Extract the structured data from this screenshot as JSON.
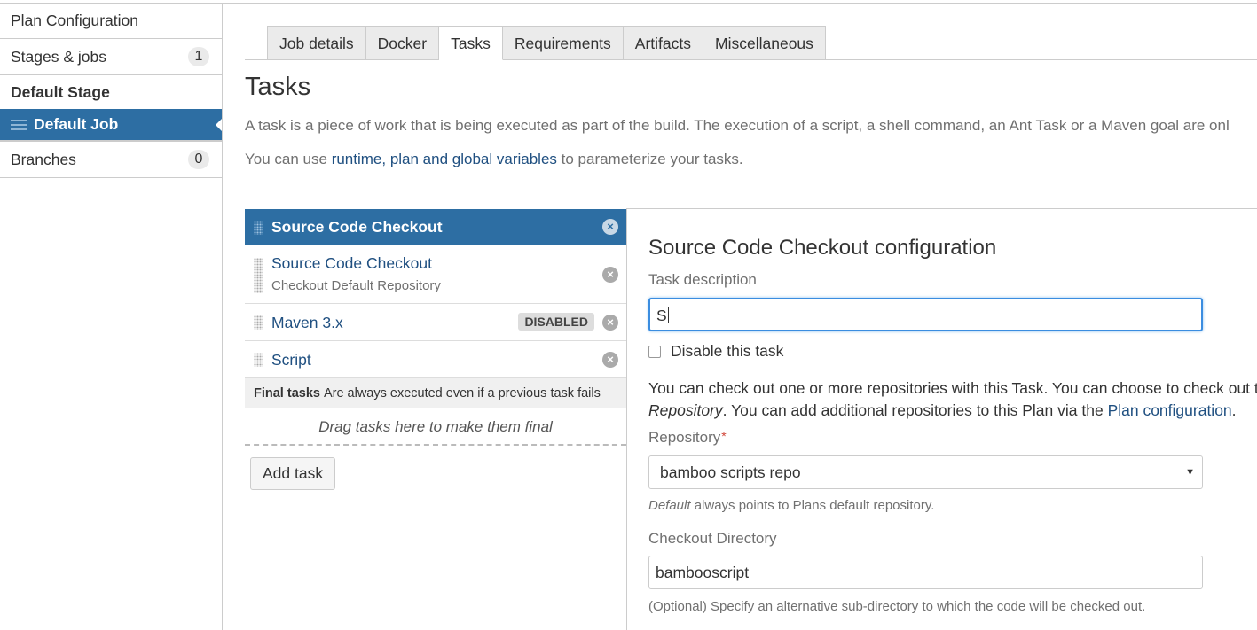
{
  "sidebar": {
    "plan_configuration": "Plan Configuration",
    "stages_jobs": {
      "label": "Stages & jobs",
      "count": "1"
    },
    "stage_name": "Default Stage",
    "job_name": "Default Job",
    "branches": {
      "label": "Branches",
      "count": "0"
    }
  },
  "tabs": [
    "Job details",
    "Docker",
    "Tasks",
    "Requirements",
    "Artifacts",
    "Miscellaneous"
  ],
  "active_tab": "Tasks",
  "page": {
    "title": "Tasks",
    "description": "A task is a piece of work that is being executed as part of the build. The execution of a script, a shell command, an Ant Task or a Maven goal are onl",
    "variables_prefix": "You can use ",
    "variables_link": "runtime, plan and global variables",
    "variables_suffix": " to parameterize your tasks."
  },
  "task_list": {
    "selected_task": "Source Code Checkout",
    "tasks": [
      {
        "title": "Source Code Checkout",
        "subtitle": "Checkout Default Repository"
      },
      {
        "title": "Maven 3.x",
        "badge": "DISABLED"
      },
      {
        "title": "Script"
      }
    ],
    "final_tasks_label": "Final tasks",
    "final_tasks_note": "Are always executed even if a previous task fails",
    "drop_zone": "Drag tasks here to make them final",
    "add_task": "Add task",
    "remove_glyph": "×"
  },
  "config": {
    "heading": "Source Code Checkout configuration",
    "task_description_label": "Task description",
    "task_description_value": "S",
    "disable_task_label": "Disable this task",
    "help_line1": "You can check out one or more repositories with this Task. You can choose to check out t",
    "help_line2_italic": "Repository",
    "help_line2_mid": ". You can add additional repositories to this Plan via the ",
    "help_line2_link": "Plan configuration",
    "help_line2_end": ".",
    "repository_label": "Repository",
    "required_mark": "*",
    "repository_value": "bamboo scripts repo",
    "repository_hint_italic": "Default",
    "repository_hint_rest": " always points to Plans default repository.",
    "checkout_dir_label": "Checkout Directory",
    "checkout_dir_value": "bambooscript",
    "checkout_dir_hint": "(Optional) Specify an alternative sub-directory to which the code will be checked out."
  },
  "colors": {
    "accent": "#2d6ea3",
    "link": "#205081",
    "focus": "#3b8de0"
  },
  "icons": {
    "drag_handle": "drag-handle-icon",
    "remove": "remove-icon",
    "list": "list-icon",
    "dropdown": "chevron-down-icon"
  }
}
